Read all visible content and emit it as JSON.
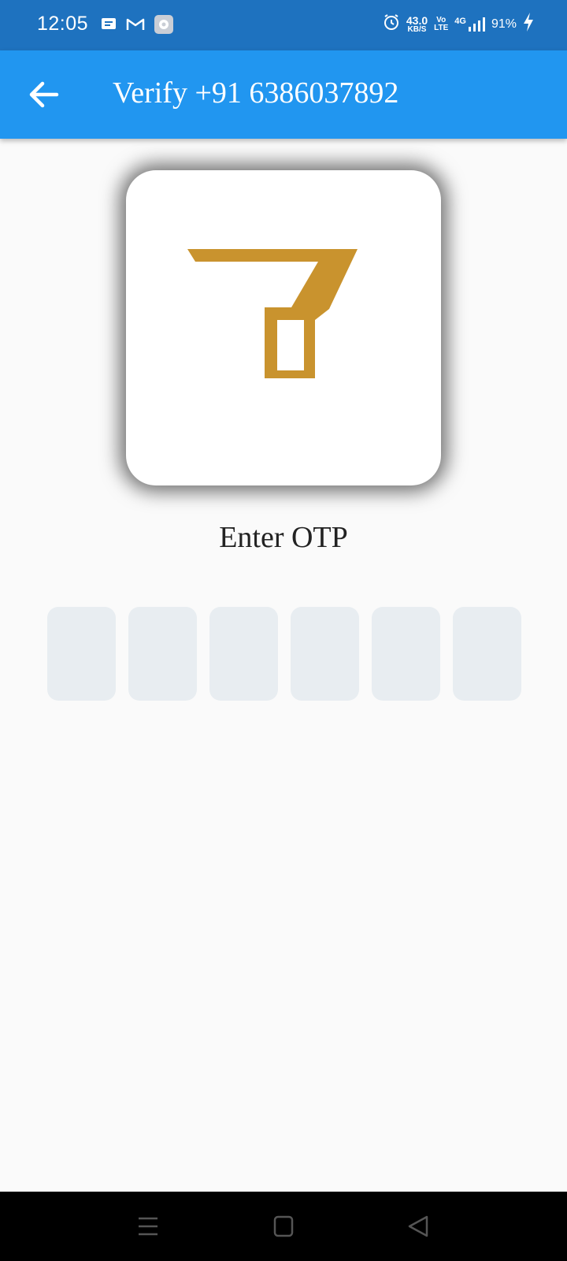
{
  "status_bar": {
    "time": "12:05",
    "net_speed_value": "43.0",
    "net_speed_unit": "KB/S",
    "volte_top": "Vo",
    "volte_bottom": "LTE",
    "network_type": "4G",
    "battery": "91%",
    "icons": [
      "message-icon",
      "gmail-icon",
      "settings-app-icon",
      "alarm-icon",
      "signal-icon",
      "charging-icon"
    ]
  },
  "app_bar": {
    "title": "Verify +91 6386037892",
    "back_icon": "arrow-left-icon"
  },
  "logo": {
    "name": "brand-logo",
    "color": "#c9932e"
  },
  "otp": {
    "label": "Enter OTP",
    "fields": [
      "",
      "",
      "",
      "",
      "",
      ""
    ],
    "field_color": "#e8edf1"
  },
  "nav_bar": {
    "buttons": [
      "menu-icon",
      "home-icon",
      "back-triangle-icon"
    ]
  },
  "colors": {
    "status_bar": "#1e72bf",
    "app_bar": "#2196f0",
    "background": "#fafafa"
  }
}
